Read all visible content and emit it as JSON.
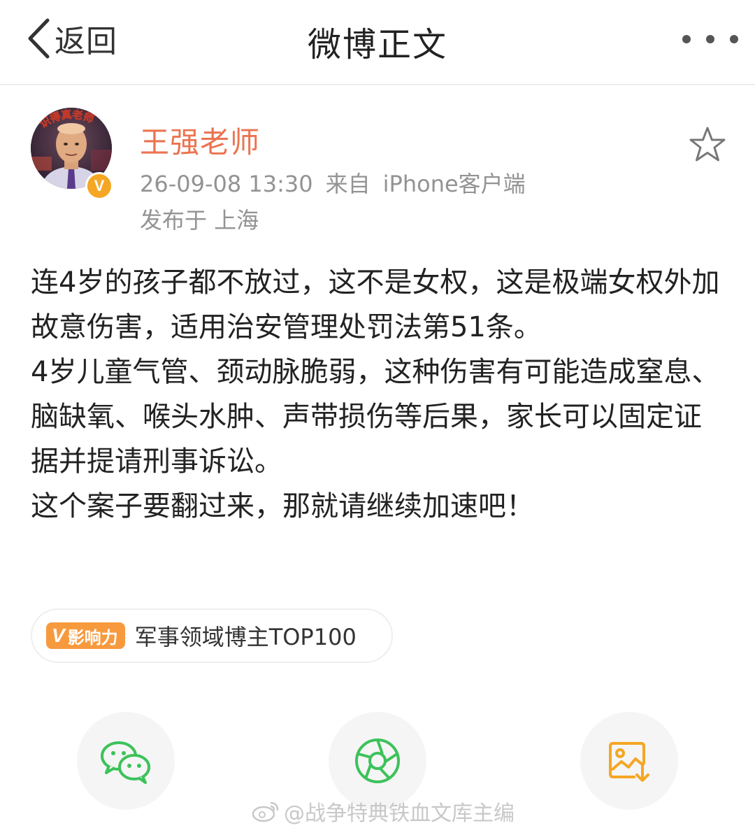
{
  "header": {
    "back_label": "返回",
    "title": "微博正文"
  },
  "author": {
    "name": "王强老师",
    "avatar_caption": "识得真老师",
    "verified_mark": "V",
    "timestamp": "26-09-08 13:30",
    "source_prefix": "来自",
    "source": "iPhone客户端",
    "location": "发布于 上海"
  },
  "post": {
    "paragraphs": [
      "连4岁的孩子都不放过，这不是女权，这是极端女权外加故意伤害，适用治安管理处罚法第51条。",
      "4岁儿童气管、颈动脉脆弱，这种伤害有可能造成窒息、脑缺氧、喉头水肿、声带损伤等后果，家长可以固定证据并提请刑事诉讼。",
      "这个案子要翻过来，那就请继续加速吧！"
    ]
  },
  "influence": {
    "tag_v": "V",
    "tag_label": "影响力",
    "text": "军事领域博主TOP100"
  },
  "share": {
    "items": [
      {
        "icon": "wechat-icon",
        "color": "#3cc25a"
      },
      {
        "icon": "moments-icon",
        "color": "#3cc25a"
      },
      {
        "icon": "save-image-icon",
        "color": "#f5a623"
      }
    ]
  },
  "watermark": {
    "text": "@战争特典铁血文库主编"
  },
  "colors": {
    "author_name": "#eb7350",
    "meta": "#939393",
    "influence_tag": "#f79a3e",
    "verified": "#f5a623"
  }
}
